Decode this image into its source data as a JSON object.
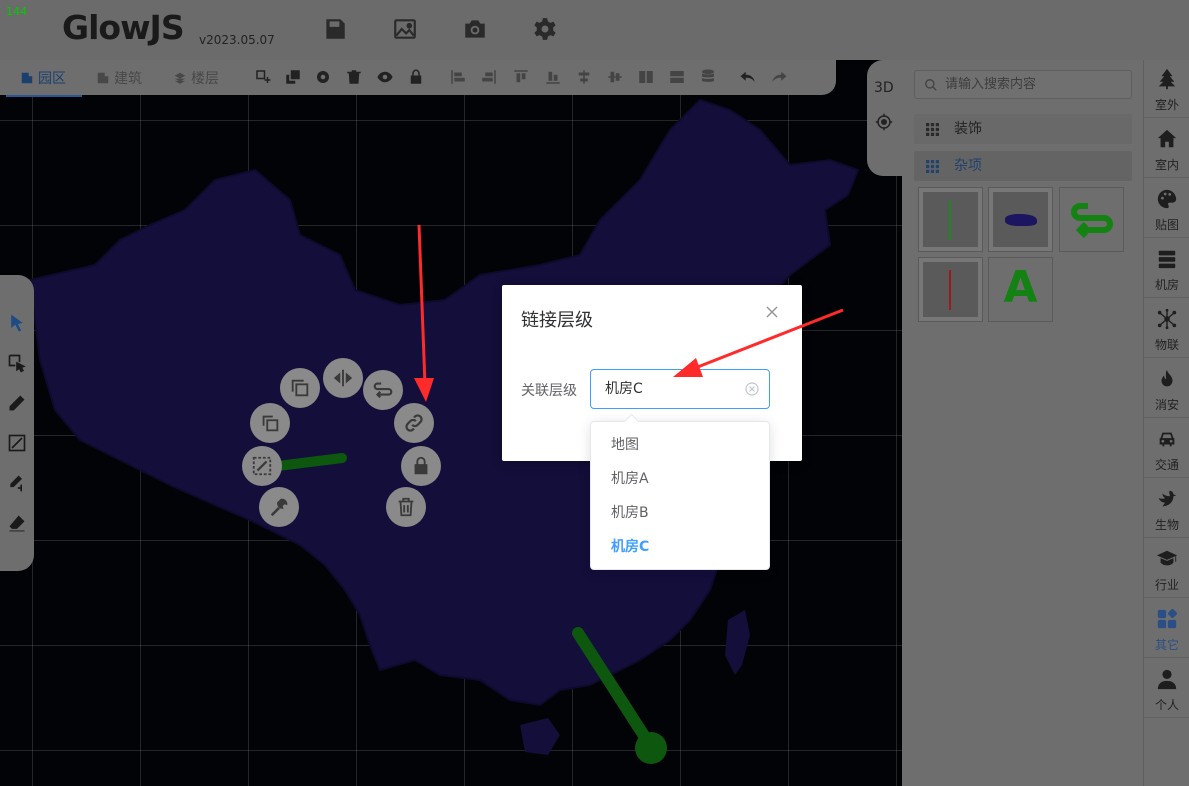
{
  "app": {
    "fps": "144",
    "logo_text": "GlowJS",
    "version": "v2023.05.07"
  },
  "toolbar": {
    "tabs": [
      {
        "label": "园区",
        "icon": "building-icon",
        "active": true
      },
      {
        "label": "建筑",
        "icon": "building-icon",
        "active": false
      },
      {
        "label": "楼层",
        "icon": "layers-icon",
        "active": false
      }
    ]
  },
  "view": {
    "mode_label": "3D"
  },
  "search": {
    "placeholder": "请输入搜索内容"
  },
  "categories": [
    {
      "label": "装饰",
      "active": false
    },
    {
      "label": "杂项",
      "active": true
    }
  ],
  "thumbnails": [
    {
      "name": "green-line-item"
    },
    {
      "name": "map-item"
    },
    {
      "name": "loop-arrow-item"
    },
    {
      "name": "red-line-item"
    },
    {
      "name": "text-item",
      "label": "A"
    }
  ],
  "sidebar": {
    "items": [
      {
        "label": "室外",
        "icon": "tree-icon"
      },
      {
        "label": "室内",
        "icon": "house-icon"
      },
      {
        "label": "贴图",
        "icon": "palette-icon"
      },
      {
        "label": "机房",
        "icon": "server-icon"
      },
      {
        "label": "物联",
        "icon": "network-icon"
      },
      {
        "label": "消安",
        "icon": "fire-icon"
      },
      {
        "label": "交通",
        "icon": "car-icon"
      },
      {
        "label": "生物",
        "icon": "bird-icon"
      },
      {
        "label": "行业",
        "icon": "graduation-cap-icon"
      },
      {
        "label": "其它",
        "icon": "apps-icon",
        "active": true
      },
      {
        "label": "个人",
        "icon": "user-icon"
      }
    ]
  },
  "dialog": {
    "title": "链接层级",
    "field_label": "关联层级",
    "selected_value": "机房C",
    "options": [
      "地图",
      "机房A",
      "机房B",
      "机房C"
    ],
    "selected_index": 3
  },
  "colors": {
    "map_fill": "#241a6b",
    "accent": "#409eff",
    "pin_green": "#1a9e1a",
    "annotation_red": "#ff2a2a"
  }
}
